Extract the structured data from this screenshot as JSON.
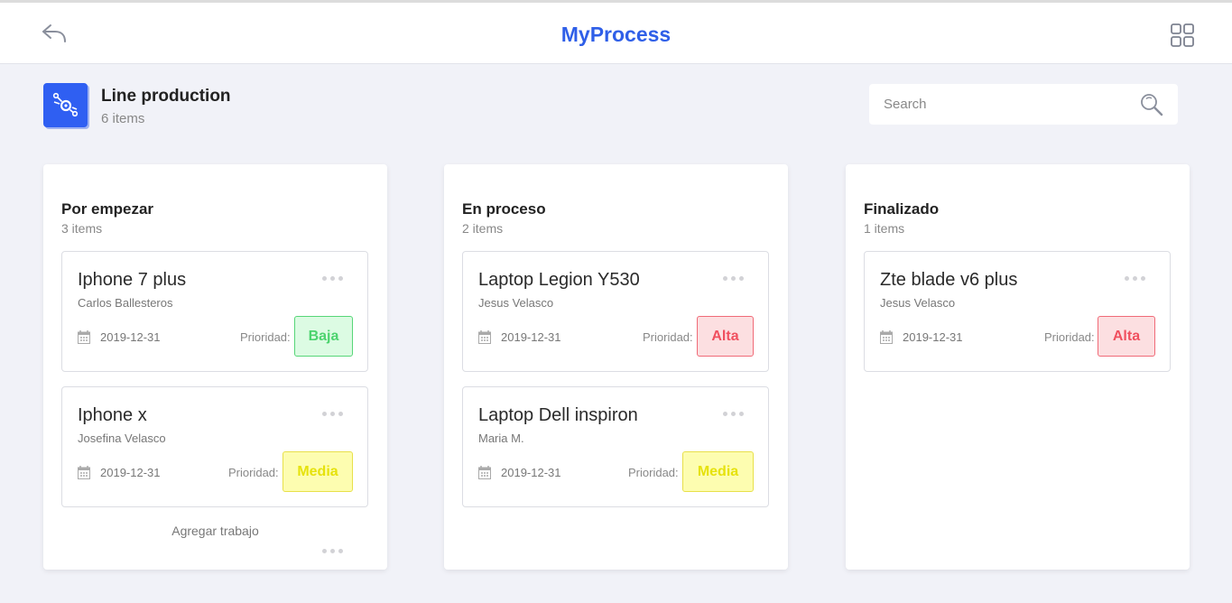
{
  "header": {
    "title": "MyProcess",
    "back_icon": "reply-arrow-icon",
    "menu_icon": "grid-icon"
  },
  "board": {
    "icon": "process-gear-icon",
    "title": "Line production",
    "count": "6 items"
  },
  "search": {
    "placeholder": "Search",
    "value": ""
  },
  "columns": [
    {
      "title": "Por empezar",
      "count": "3 items",
      "add_label": "Agregar trabajo",
      "cards": [
        {
          "title": "Iphone 7 plus",
          "owner": "Carlos Ballesteros",
          "date": "2019-12-31",
          "priority_label": "Prioridad:",
          "priority": "Baja"
        },
        {
          "title": "Iphone x",
          "owner": "Josefina Velasco",
          "date": "2019-12-31",
          "priority_label": "Prioridad:",
          "priority": "Media"
        }
      ]
    },
    {
      "title": "En proceso",
      "count": "2 items",
      "cards": [
        {
          "title": "Laptop Legion Y530",
          "owner": "Jesus Velasco",
          "date": "2019-12-31",
          "priority_label": "Prioridad:",
          "priority": "Alta"
        },
        {
          "title": "Laptop Dell inspiron",
          "owner": "Maria M.",
          "date": "2019-12-31",
          "priority_label": "Prioridad:",
          "priority": "Media"
        }
      ]
    },
    {
      "title": "Finalizado",
      "count": "1 items",
      "cards": [
        {
          "title": "Zte blade v6 plus",
          "owner": "Jesus Velasco",
          "date": "2019-12-31",
          "priority_label": "Prioridad:",
          "priority": "Alta"
        }
      ]
    }
  ],
  "colors": {
    "accent": "#2f5fe8",
    "baja": "#4cd36e",
    "alta": "#f0505f",
    "media": "#e6e20c"
  }
}
